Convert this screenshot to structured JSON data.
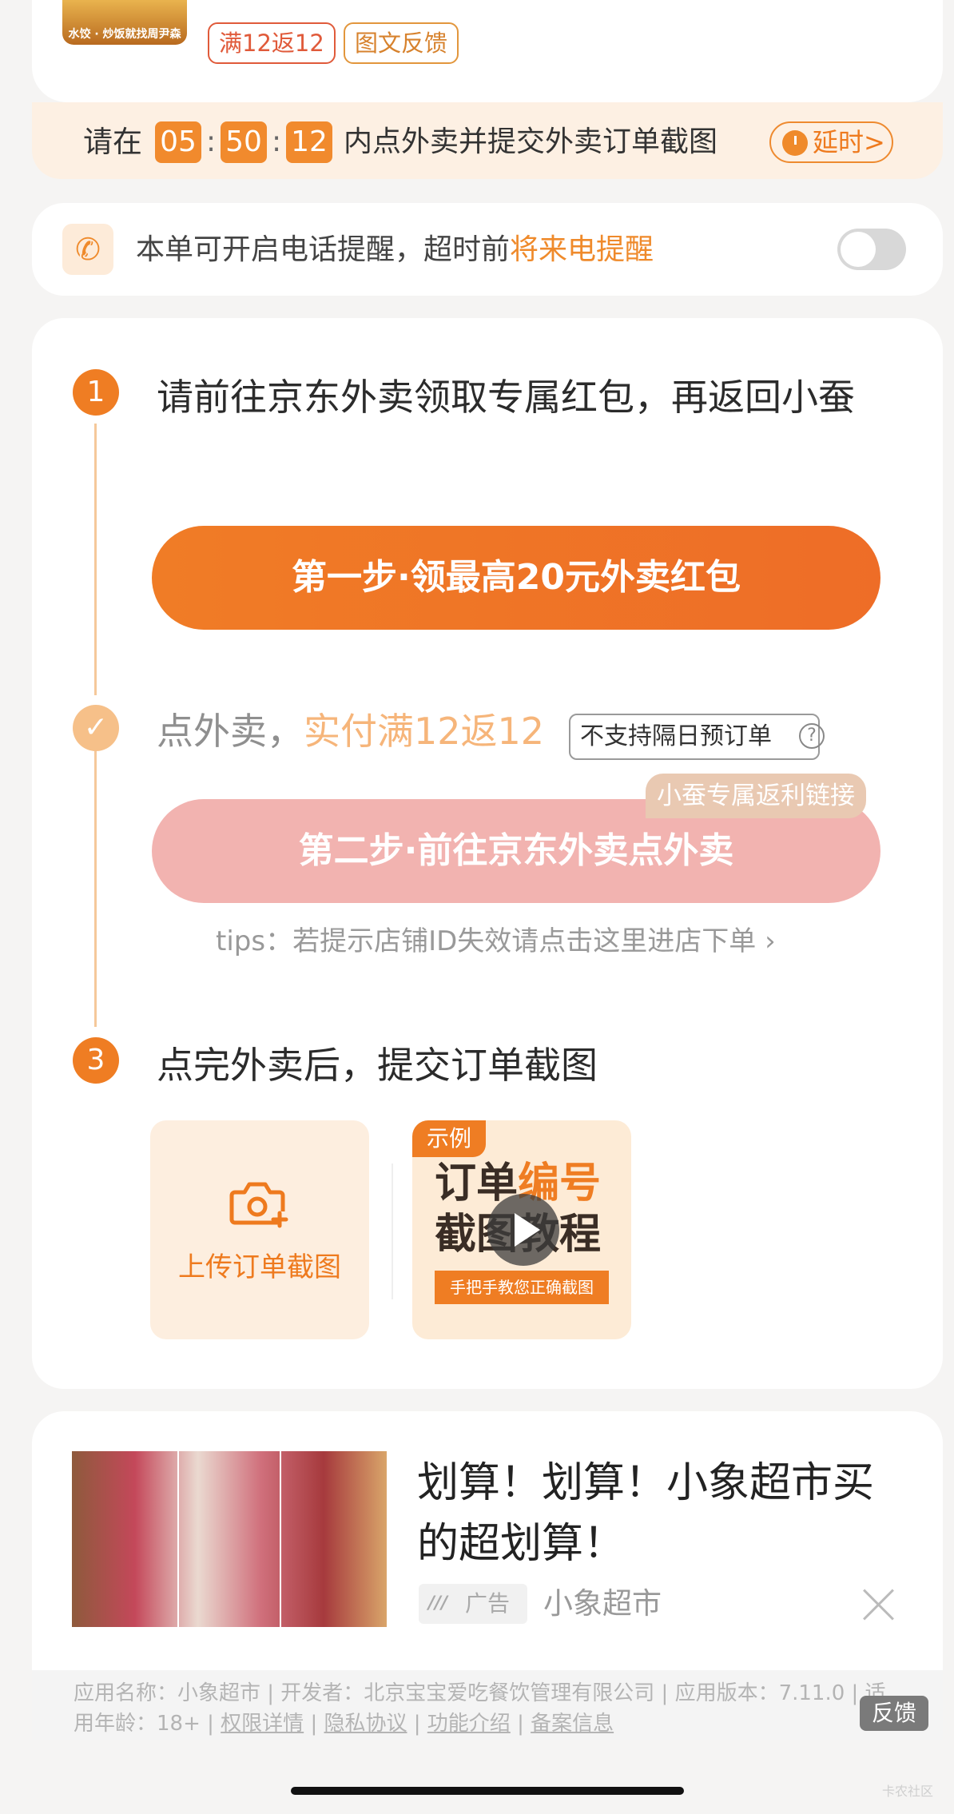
{
  "shop": {
    "thumb_caption": "水饺 · 炒饭就找周尹森",
    "tags": [
      "满12返12",
      "图文反馈"
    ]
  },
  "countdown": {
    "prefix": "请在",
    "hours": "05",
    "minutes": "50",
    "seconds": "12",
    "suffix": "内点外卖并提交外卖订单截图",
    "delay_label": "延时>"
  },
  "reminder": {
    "text": "本单可开启电话提醒，超时前",
    "highlight": "将来电提醒",
    "toggle_on": false
  },
  "steps": {
    "step1": {
      "number": "1",
      "text": "请前往京东外卖领取专属红包，再返回小蚕",
      "button": "第一步·领最高20元外卖红包"
    },
    "step2": {
      "text_prefix": "点外卖，",
      "highlight": "实付满12返12",
      "badge": "不支持隔日预订单",
      "exclusive_label": "小蚕专属返利链接",
      "button": "第二步·前往京东外卖点外卖",
      "tips": "tips：若提示店铺ID失效请点击这里进店下单 ›"
    },
    "step3": {
      "number": "3",
      "text": "点完外卖后，提交订单截图",
      "upload_label": "上传订单截图",
      "example": {
        "badge": "示例",
        "line1_a": "订单",
        "line1_b": "编号",
        "line2": "截图教程",
        "sub": "手把手教您正确截图"
      }
    }
  },
  "ad": {
    "title": "划算！划算！小象超市买的超划算！",
    "tag": "广告",
    "brand": "小象超市",
    "app_info": {
      "prefix": "应用名称：小象超市 | 开发者：北京宝宝爱吃餐饮管理有限公司 | 应用版本：7.11.0 | 适用年龄：18+ | ",
      "links": [
        "权限详情",
        "隐私协议",
        "功能介绍",
        "备案信息"
      ]
    },
    "feedback": "反馈"
  },
  "watermark": "卡农社区",
  "colors": {
    "accent": "#ef7d23",
    "accent_light": "#f6c089",
    "pink_button": "#f2b3b0",
    "countdown_bg": "#fdf0e3"
  }
}
